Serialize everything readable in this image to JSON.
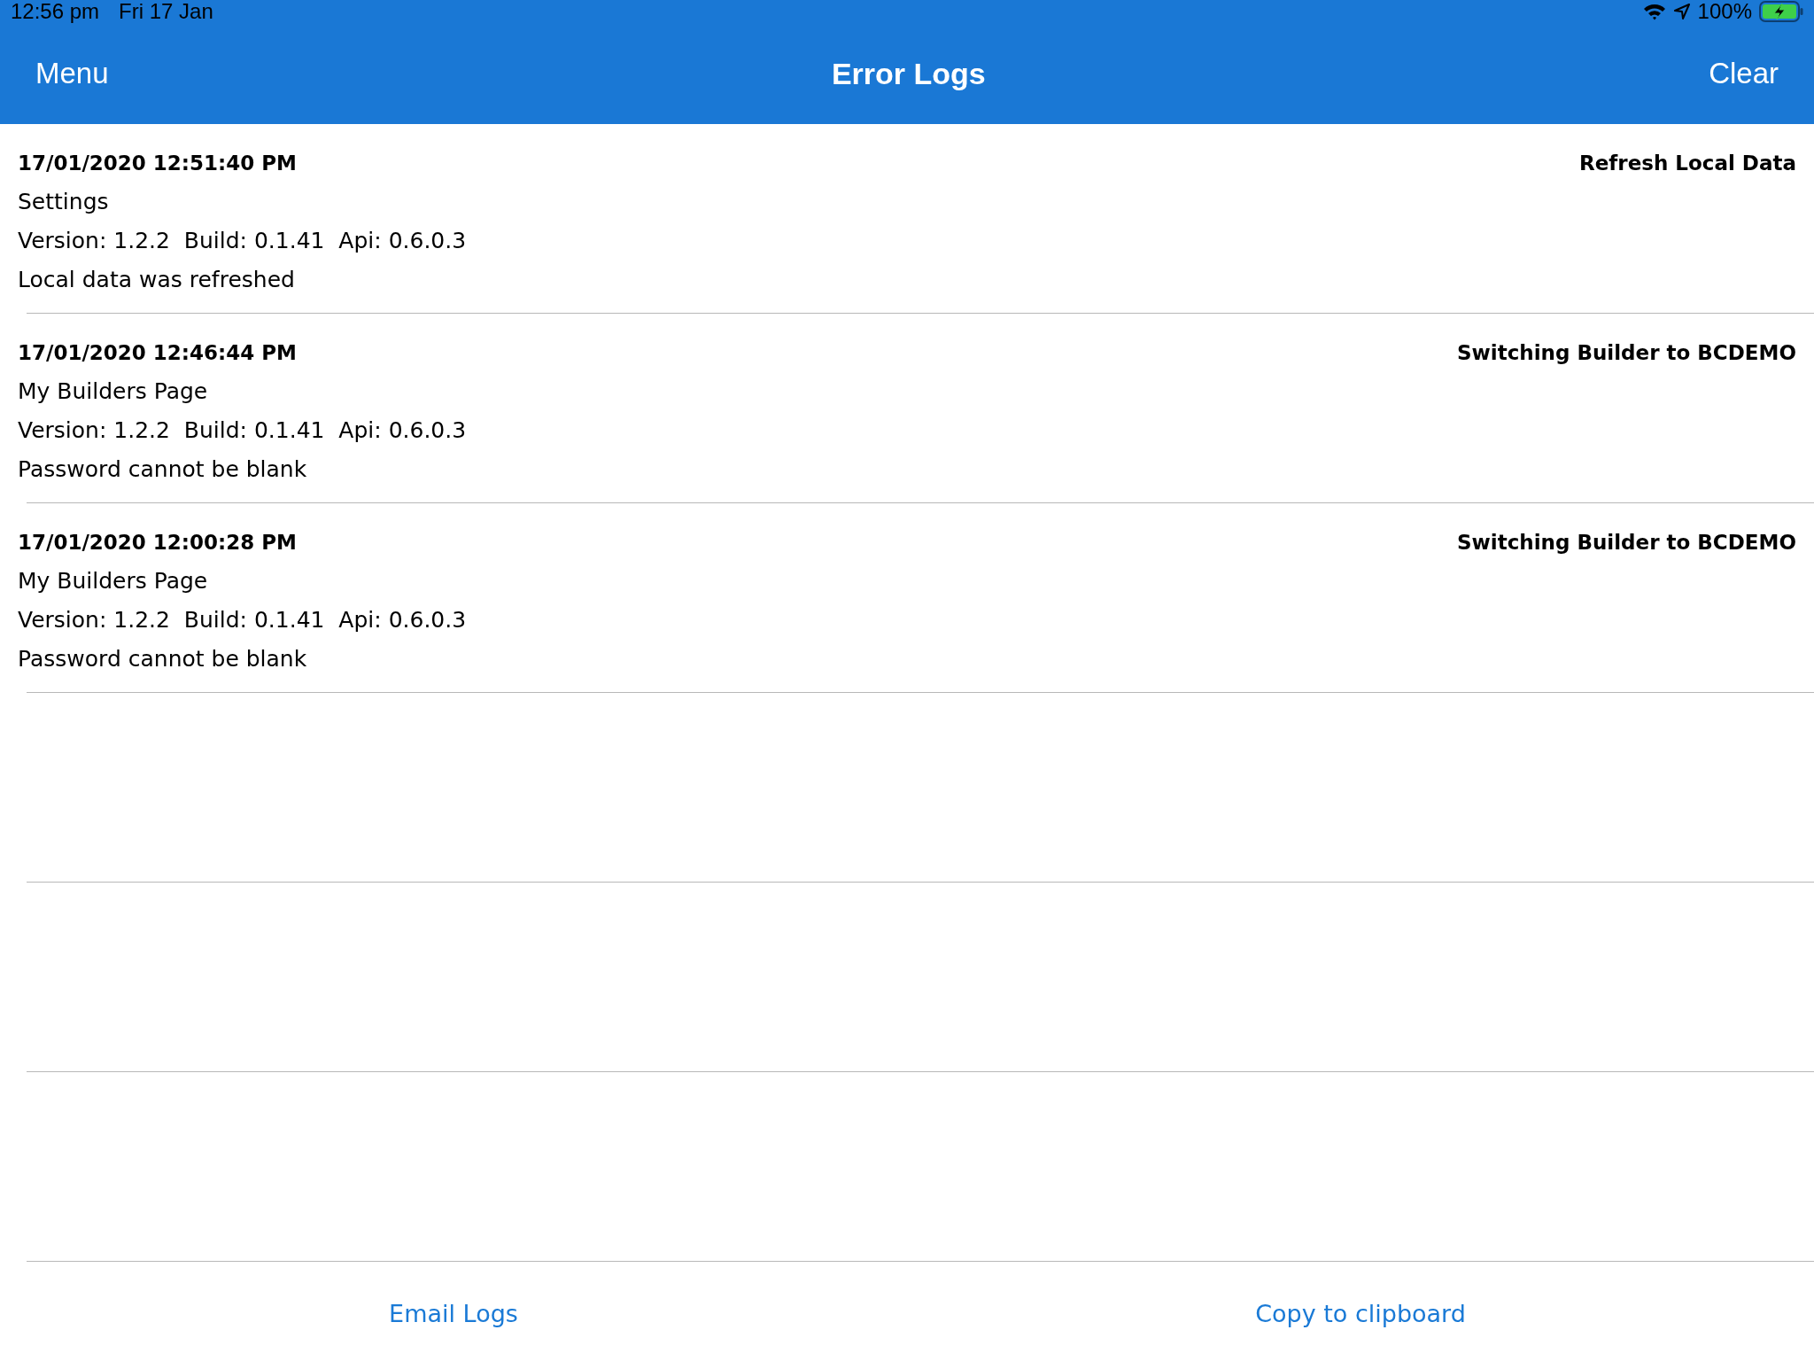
{
  "status_bar": {
    "time": "12:56 pm",
    "date": "Fri 17 Jan",
    "battery": "100%"
  },
  "nav_bar": {
    "left_button": "Menu",
    "title": "Error Logs",
    "right_button": "Clear"
  },
  "logs": [
    {
      "timestamp": "17/01/2020 12:51:40 PM",
      "action": "Refresh Local Data",
      "page": "Settings",
      "version": "Version: 1.2.2  Build: 0.1.41  Api: 0.6.0.3",
      "message": "Local data was refreshed"
    },
    {
      "timestamp": "17/01/2020 12:46:44 PM",
      "action": "Switching Builder to BCDEMO",
      "page": "My Builders Page",
      "version": "Version: 1.2.2  Build: 0.1.41  Api: 0.6.0.3",
      "message": "Password cannot be blank"
    },
    {
      "timestamp": "17/01/2020 12:00:28 PM",
      "action": "Switching Builder to BCDEMO",
      "page": "My Builders Page",
      "version": "Version: 1.2.2  Build: 0.1.41  Api: 0.6.0.3",
      "message": "Password cannot be blank"
    }
  ],
  "footer_buttons": [
    "Email Logs",
    "Copy to clipboard"
  ]
}
